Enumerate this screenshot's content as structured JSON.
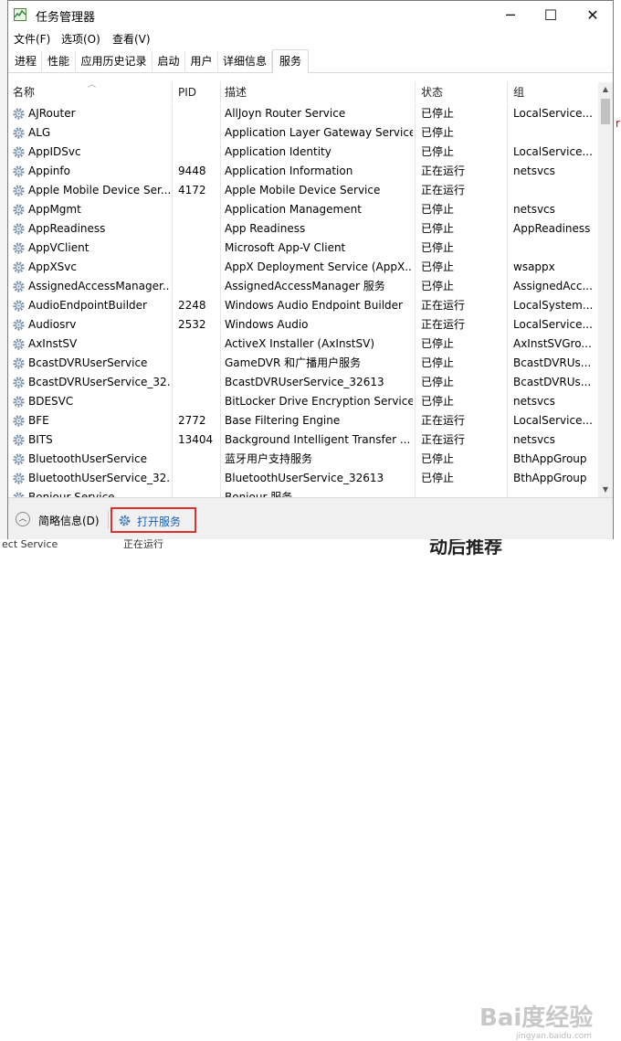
{
  "window": {
    "title": "任务管理器",
    "minimize": "─",
    "maximize": "☐",
    "close": "✕"
  },
  "menu": [
    "文件(F)",
    "选项(O)",
    "查看(V)"
  ],
  "tabs": [
    "进程",
    "性能",
    "应用历史记录",
    "启动",
    "用户",
    "详细信息",
    "服务"
  ],
  "active_tab": "服务",
  "columns": {
    "name": "名称",
    "pid": "PID",
    "desc": "描述",
    "status": "状态",
    "group": "组"
  },
  "rows": [
    {
      "name": "AJRouter",
      "pid": "",
      "desc": "AllJoyn Router Service",
      "status": "已停止",
      "group": "LocalService..."
    },
    {
      "name": "ALG",
      "pid": "",
      "desc": "Application Layer Gateway Service",
      "status": "已停止",
      "group": ""
    },
    {
      "name": "AppIDSvc",
      "pid": "",
      "desc": "Application Identity",
      "status": "已停止",
      "group": "LocalService..."
    },
    {
      "name": "Appinfo",
      "pid": "9448",
      "desc": "Application Information",
      "status": "正在运行",
      "group": "netsvcs"
    },
    {
      "name": "Apple Mobile Device Ser...",
      "pid": "4172",
      "desc": "Apple Mobile Device Service",
      "status": "正在运行",
      "group": ""
    },
    {
      "name": "AppMgmt",
      "pid": "",
      "desc": "Application Management",
      "status": "已停止",
      "group": "netsvcs"
    },
    {
      "name": "AppReadiness",
      "pid": "",
      "desc": "App Readiness",
      "status": "已停止",
      "group": "AppReadiness"
    },
    {
      "name": "AppVClient",
      "pid": "",
      "desc": "Microsoft App-V Client",
      "status": "已停止",
      "group": ""
    },
    {
      "name": "AppXSvc",
      "pid": "",
      "desc": "AppX Deployment Service (AppX...",
      "status": "已停止",
      "group": "wsappx"
    },
    {
      "name": "AssignedAccessManager...",
      "pid": "",
      "desc": "AssignedAccessManager 服务",
      "status": "已停止",
      "group": "AssignedAcc..."
    },
    {
      "name": "AudioEndpointBuilder",
      "pid": "2248",
      "desc": "Windows Audio Endpoint Builder",
      "status": "正在运行",
      "group": "LocalSystem..."
    },
    {
      "name": "Audiosrv",
      "pid": "2532",
      "desc": "Windows Audio",
      "status": "正在运行",
      "group": "LocalService..."
    },
    {
      "name": "AxInstSV",
      "pid": "",
      "desc": "ActiveX Installer (AxInstSV)",
      "status": "已停止",
      "group": "AxInstSVGro..."
    },
    {
      "name": "BcastDVRUserService",
      "pid": "",
      "desc": "GameDVR 和广播用户服务",
      "status": "已停止",
      "group": "BcastDVRUs..."
    },
    {
      "name": "BcastDVRUserService_32...",
      "pid": "",
      "desc": "BcastDVRUserService_32613",
      "status": "已停止",
      "group": "BcastDVRUs..."
    },
    {
      "name": "BDESVC",
      "pid": "",
      "desc": "BitLocker Drive Encryption Service",
      "status": "已停止",
      "group": "netsvcs"
    },
    {
      "name": "BFE",
      "pid": "2772",
      "desc": "Base Filtering Engine",
      "status": "正在运行",
      "group": "LocalService..."
    },
    {
      "name": "BITS",
      "pid": "13404",
      "desc": "Background Intelligent Transfer ...",
      "status": "正在运行",
      "group": "netsvcs"
    },
    {
      "name": "BluetoothUserService",
      "pid": "",
      "desc": "蓝牙用户支持服务",
      "status": "已停止",
      "group": "BthAppGroup"
    },
    {
      "name": "BluetoothUserService_32...",
      "pid": "",
      "desc": "BluetoothUserService_32613",
      "status": "已停止",
      "group": "BthAppGroup"
    },
    {
      "name": "Bonjour Service",
      "pid": "",
      "desc": "Bonjour 服务",
      "status": "",
      "group": ""
    }
  ],
  "footer": {
    "brief": "简略信息(D)",
    "open_services": "打开服务"
  },
  "watermark": "Bai度经验",
  "watermark_url": "jingyan.baidu.com",
  "background": {
    "bottom_left": "ect Service",
    "bottom_mid": "正在运行",
    "big_text": "动后推荐"
  }
}
